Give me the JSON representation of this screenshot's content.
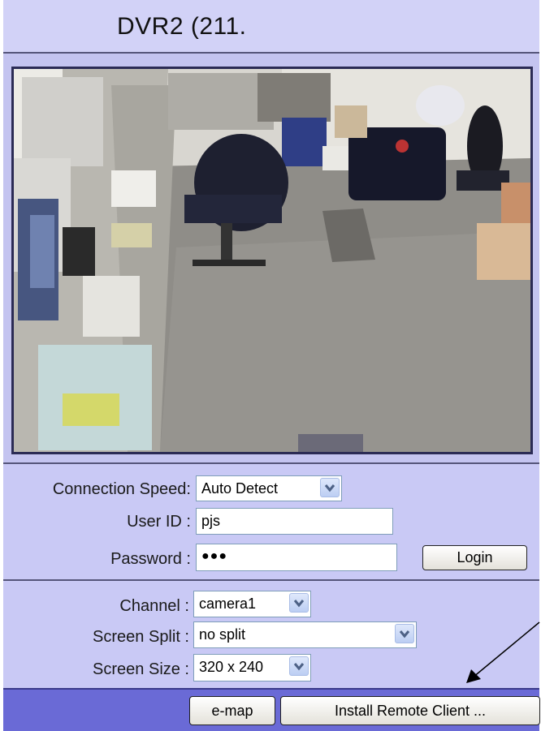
{
  "title": "DVR2 (211.",
  "login": {
    "connection_speed_label": "Connection Speed:",
    "connection_speed_value": "Auto Detect",
    "user_id_label": "User ID :",
    "user_id_value": "pjs",
    "password_label": "Password :",
    "password_value": "●●●",
    "login_button": "Login"
  },
  "view": {
    "channel_label": "Channel :",
    "channel_value": "camera1",
    "screen_split_label": "Screen Split :",
    "screen_split_value": "no split",
    "screen_size_label": "Screen Size :",
    "screen_size_value": "320 x 240"
  },
  "footer": {
    "emap_button": "e-map",
    "install_button": "Install Remote Client ..."
  },
  "colors": {
    "panel": "#c9c9f5",
    "footer": "#6a6ad6"
  },
  "icons": [
    "chevron-down-icon",
    "arrow-icon"
  ]
}
